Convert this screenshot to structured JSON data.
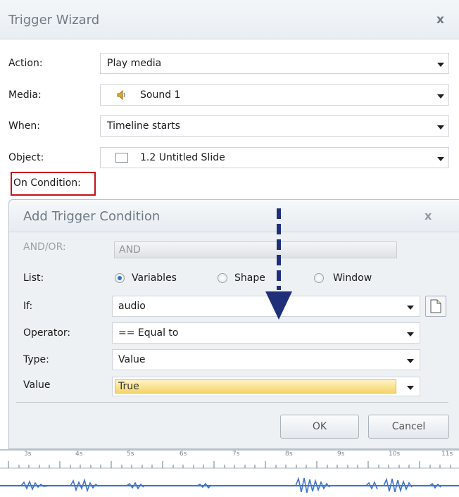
{
  "wizard": {
    "title": "Trigger Wizard",
    "close_glyph": "x",
    "action_label": "Action:",
    "action_value": "Play media",
    "media_label": "Media:",
    "media_value": "Sound 1",
    "media_icon": "speaker-icon",
    "when_label": "When:",
    "when_value": "Timeline starts",
    "object_label": "Object:",
    "object_value": "1.2 Untitled Slide",
    "object_icon": "slide-thumbnail-icon",
    "condition_label": "On Condition:",
    "highlight_color": "#c4121b"
  },
  "condition_dialog": {
    "title": "Add Trigger Condition",
    "close_glyph": "x",
    "andor_label": "AND/OR:",
    "andor_value": "AND",
    "list_label": "List:",
    "list_options": [
      "Variables",
      "Shape",
      "Window"
    ],
    "list_selected": "Variables",
    "if_label": "If:",
    "if_value": "audio",
    "operator_label": "Operator:",
    "operator_value": "== Equal to",
    "type_label": "Type:",
    "type_value": "Value",
    "value_label": "Value",
    "value_value": "True",
    "ok_label": "OK",
    "cancel_label": "Cancel",
    "arrow_color": "#1f2f7a"
  },
  "timeline": {
    "ticks": [
      "3s",
      "4s",
      "5s",
      "6s",
      "7s",
      "8s",
      "9s",
      "10s",
      "11s"
    ]
  }
}
